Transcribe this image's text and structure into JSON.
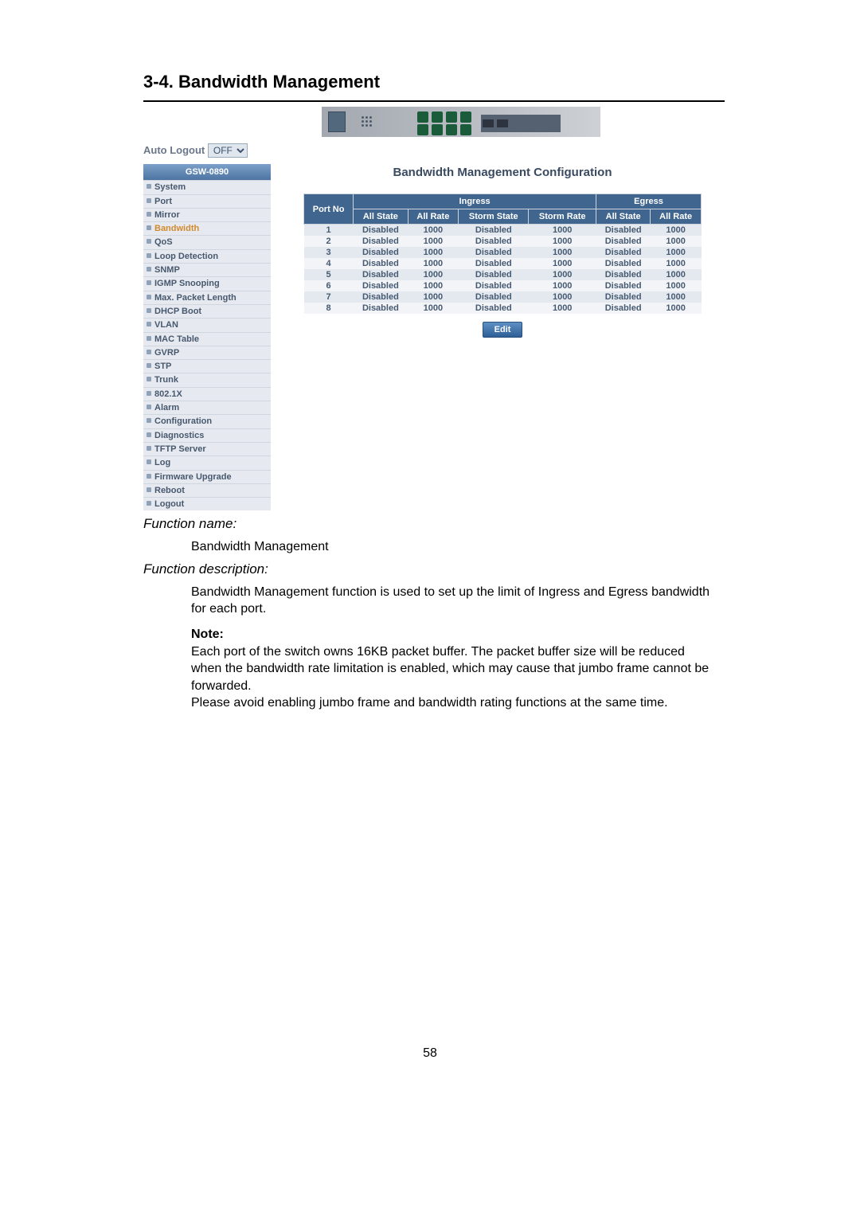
{
  "doc": {
    "title": "3-4. Bandwidth Management",
    "function_name_label": "Function name:",
    "function_name_value": "Bandwidth Management",
    "function_desc_label": "Function description:",
    "function_desc_text": "Bandwidth Management function is used to set up the limit of Ingress and Egress bandwidth for each port.",
    "note_label": "Note:",
    "note_p1": "Each port of the switch owns 16KB packet buffer. The packet buffer size will be reduced when the bandwidth rate limitation is enabled, which may cause that jumbo frame cannot be forwarded.",
    "note_p2": "Please avoid enabling jumbo frame and bandwidth rating functions at the same time.",
    "page_number": "58"
  },
  "ui": {
    "auto_logout_label": "Auto Logout",
    "auto_logout_value": "OFF",
    "nav_header": "GSW-0890",
    "nav_items": [
      {
        "label": "System",
        "active": false
      },
      {
        "label": "Port",
        "active": false
      },
      {
        "label": "Mirror",
        "active": false
      },
      {
        "label": "Bandwidth",
        "active": true
      },
      {
        "label": "QoS",
        "active": false
      },
      {
        "label": "Loop Detection",
        "active": false
      },
      {
        "label": "SNMP",
        "active": false
      },
      {
        "label": "IGMP Snooping",
        "active": false
      },
      {
        "label": "Max. Packet Length",
        "active": false
      },
      {
        "label": "DHCP Boot",
        "active": false
      },
      {
        "label": "VLAN",
        "active": false
      },
      {
        "label": "MAC Table",
        "active": false
      },
      {
        "label": "GVRP",
        "active": false
      },
      {
        "label": "STP",
        "active": false
      },
      {
        "label": "Trunk",
        "active": false
      },
      {
        "label": "802.1X",
        "active": false
      },
      {
        "label": "Alarm",
        "active": false
      },
      {
        "label": "Configuration",
        "active": false
      },
      {
        "label": "Diagnostics",
        "active": false
      },
      {
        "label": "TFTP Server",
        "active": false
      },
      {
        "label": "Log",
        "active": false
      },
      {
        "label": "Firmware Upgrade",
        "active": false
      },
      {
        "label": "Reboot",
        "active": false
      },
      {
        "label": "Logout",
        "active": false
      }
    ],
    "panel_title": "Bandwidth Management Configuration",
    "table": {
      "header_port": "Port No",
      "header_ingress": "Ingress",
      "header_egress": "Egress",
      "sub_all_state": "All State",
      "sub_all_rate": "All Rate",
      "sub_storm_state": "Storm State",
      "sub_storm_rate": "Storm Rate",
      "rows": [
        {
          "port": "1",
          "in_all_state": "Disabled",
          "in_all_rate": "1000",
          "in_storm_state": "Disabled",
          "in_storm_rate": "1000",
          "eg_all_state": "Disabled",
          "eg_all_rate": "1000"
        },
        {
          "port": "2",
          "in_all_state": "Disabled",
          "in_all_rate": "1000",
          "in_storm_state": "Disabled",
          "in_storm_rate": "1000",
          "eg_all_state": "Disabled",
          "eg_all_rate": "1000"
        },
        {
          "port": "3",
          "in_all_state": "Disabled",
          "in_all_rate": "1000",
          "in_storm_state": "Disabled",
          "in_storm_rate": "1000",
          "eg_all_state": "Disabled",
          "eg_all_rate": "1000"
        },
        {
          "port": "4",
          "in_all_state": "Disabled",
          "in_all_rate": "1000",
          "in_storm_state": "Disabled",
          "in_storm_rate": "1000",
          "eg_all_state": "Disabled",
          "eg_all_rate": "1000"
        },
        {
          "port": "5",
          "in_all_state": "Disabled",
          "in_all_rate": "1000",
          "in_storm_state": "Disabled",
          "in_storm_rate": "1000",
          "eg_all_state": "Disabled",
          "eg_all_rate": "1000"
        },
        {
          "port": "6",
          "in_all_state": "Disabled",
          "in_all_rate": "1000",
          "in_storm_state": "Disabled",
          "in_storm_rate": "1000",
          "eg_all_state": "Disabled",
          "eg_all_rate": "1000"
        },
        {
          "port": "7",
          "in_all_state": "Disabled",
          "in_all_rate": "1000",
          "in_storm_state": "Disabled",
          "in_storm_rate": "1000",
          "eg_all_state": "Disabled",
          "eg_all_rate": "1000"
        },
        {
          "port": "8",
          "in_all_state": "Disabled",
          "in_all_rate": "1000",
          "in_storm_state": "Disabled",
          "in_storm_rate": "1000",
          "eg_all_state": "Disabled",
          "eg_all_rate": "1000"
        }
      ]
    },
    "edit_button": "Edit"
  }
}
